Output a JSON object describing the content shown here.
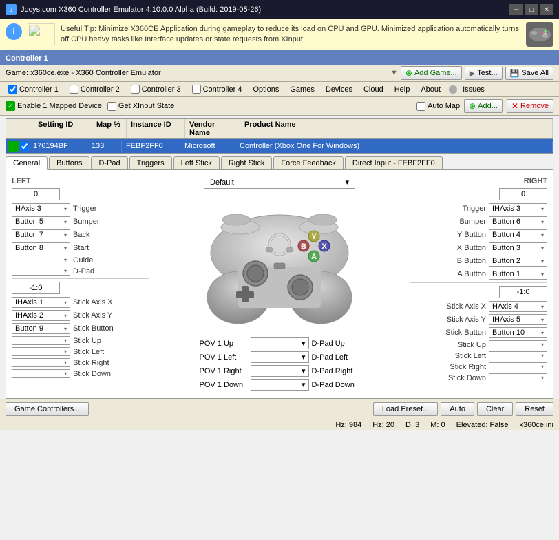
{
  "app": {
    "title": "Jocys.com X360 Controller Emulator 4.10.0.0 Alpha (Build: 2019-05-26)",
    "info_text": "Useful Tip: Minimize X360CE Application during gameplay to reduce its load on CPU and GPU. Minimized application automatically turns off CPU heavy tasks like Interface updates or state requests from XInput.",
    "info_icon": "i"
  },
  "controller_section": {
    "title": "Controller 1"
  },
  "game_bar": {
    "label": "Game:  x360ce.exe - X360 Controller Emulator",
    "add_game": "Add Game...",
    "test": "Test...",
    "save_all": "Save All"
  },
  "menu": {
    "items": [
      "Controller 1",
      "Controller 2",
      "Controller 3",
      "Controller 4",
      "Options",
      "Games",
      "Devices",
      "Cloud",
      "Help",
      "About",
      "Issues"
    ]
  },
  "toolbar": {
    "enable_label": "Enable 1 Mapped Device",
    "get_xinput": "Get XInput State",
    "auto_map": "Auto Map",
    "add": "Add...",
    "remove": "Remove"
  },
  "table": {
    "headers": [
      "Setting ID",
      "Map %",
      "Instance ID",
      "Vendor Name",
      "Product Name"
    ],
    "rows": [
      {
        "setting_id": "176194BF",
        "map_pct": "133",
        "instance_id": "FEBF2FF0",
        "vendor": "Microsoft",
        "product": "Controller (Xbox One For Windows)"
      }
    ]
  },
  "tabs": {
    "items": [
      "General",
      "Buttons",
      "D-Pad",
      "Triggers",
      "Left Stick",
      "Right Stick",
      "Force Feedback",
      "Direct Input - FEBF2FF0"
    ],
    "active": "General"
  },
  "general": {
    "left_label": "LEFT",
    "right_label": "RIGHT",
    "default_dropdown": "Default",
    "left_value": "0",
    "right_value": "0",
    "left_stick_value": "-1:0",
    "right_stick_value": "-1:0",
    "controls_left": [
      {
        "dropdown": "HAxis 3",
        "label": "Trigger"
      },
      {
        "dropdown": "Button 5",
        "label": "Bumper"
      },
      {
        "dropdown": "Button 7",
        "label": "Back"
      },
      {
        "dropdown": "Button 8",
        "label": "Start"
      },
      {
        "dropdown": "",
        "label": "Guide"
      },
      {
        "dropdown": "",
        "label": "D-Pad"
      }
    ],
    "controls_left_stick": [
      {
        "dropdown": "IHAxis 1",
        "label": "Stick Axis X"
      },
      {
        "dropdown": "IHAxis 2",
        "label": "Stick Axis Y"
      },
      {
        "dropdown": "Button 9",
        "label": "Stick Button"
      },
      {
        "dropdown": "",
        "label": "Stick Up"
      },
      {
        "dropdown": "",
        "label": "Stick Left"
      },
      {
        "dropdown": "",
        "label": "Stick Right"
      },
      {
        "dropdown": "",
        "label": "Stick Down"
      }
    ],
    "controls_right": [
      {
        "label": "Trigger",
        "dropdown": "IHAxis 3"
      },
      {
        "label": "Bumper",
        "dropdown": "Button 6"
      },
      {
        "label": "Y Button",
        "dropdown": "Button 4"
      },
      {
        "label": "X Button",
        "dropdown": "Button 3"
      },
      {
        "label": "B Button",
        "dropdown": "Button 2"
      },
      {
        "label": "A Button",
        "dropdown": "Button 1"
      }
    ],
    "controls_right_stick": [
      {
        "label": "Stick Axis X",
        "dropdown": "HAxis 4"
      },
      {
        "label": "Stick Axis Y",
        "dropdown": "IHAxis 5"
      },
      {
        "label": "Stick Button",
        "dropdown": "Button 10"
      },
      {
        "label": "Stick Up",
        "dropdown": ""
      },
      {
        "label": "Stick Left",
        "dropdown": ""
      },
      {
        "label": "Stick Right",
        "dropdown": ""
      },
      {
        "label": "Stick Down",
        "dropdown": ""
      }
    ],
    "pov_rows": [
      {
        "label": "POV 1 Up",
        "dropdown": "▾",
        "value": "D-Pad Up"
      },
      {
        "label": "POV 1 Left",
        "dropdown": "▾",
        "value": "D-Pad Left"
      },
      {
        "label": "POV 1 Right",
        "dropdown": "▾",
        "value": "D-Pad Right"
      },
      {
        "label": "POV 1 Down",
        "dropdown": "▾",
        "value": "D-Pad Down"
      }
    ]
  },
  "bottom_bar": {
    "game_controllers": "Game Controllers...",
    "load_preset": "Load Preset...",
    "auto": "Auto",
    "clear": "Clear",
    "reset": "Reset"
  },
  "status_bar": {
    "hz": "Hz: 984",
    "frame": "Hz: 20",
    "d": "D: 3",
    "m": "M: 0",
    "elevated": "Elevated: False",
    "ini": "x360ce.ini"
  }
}
